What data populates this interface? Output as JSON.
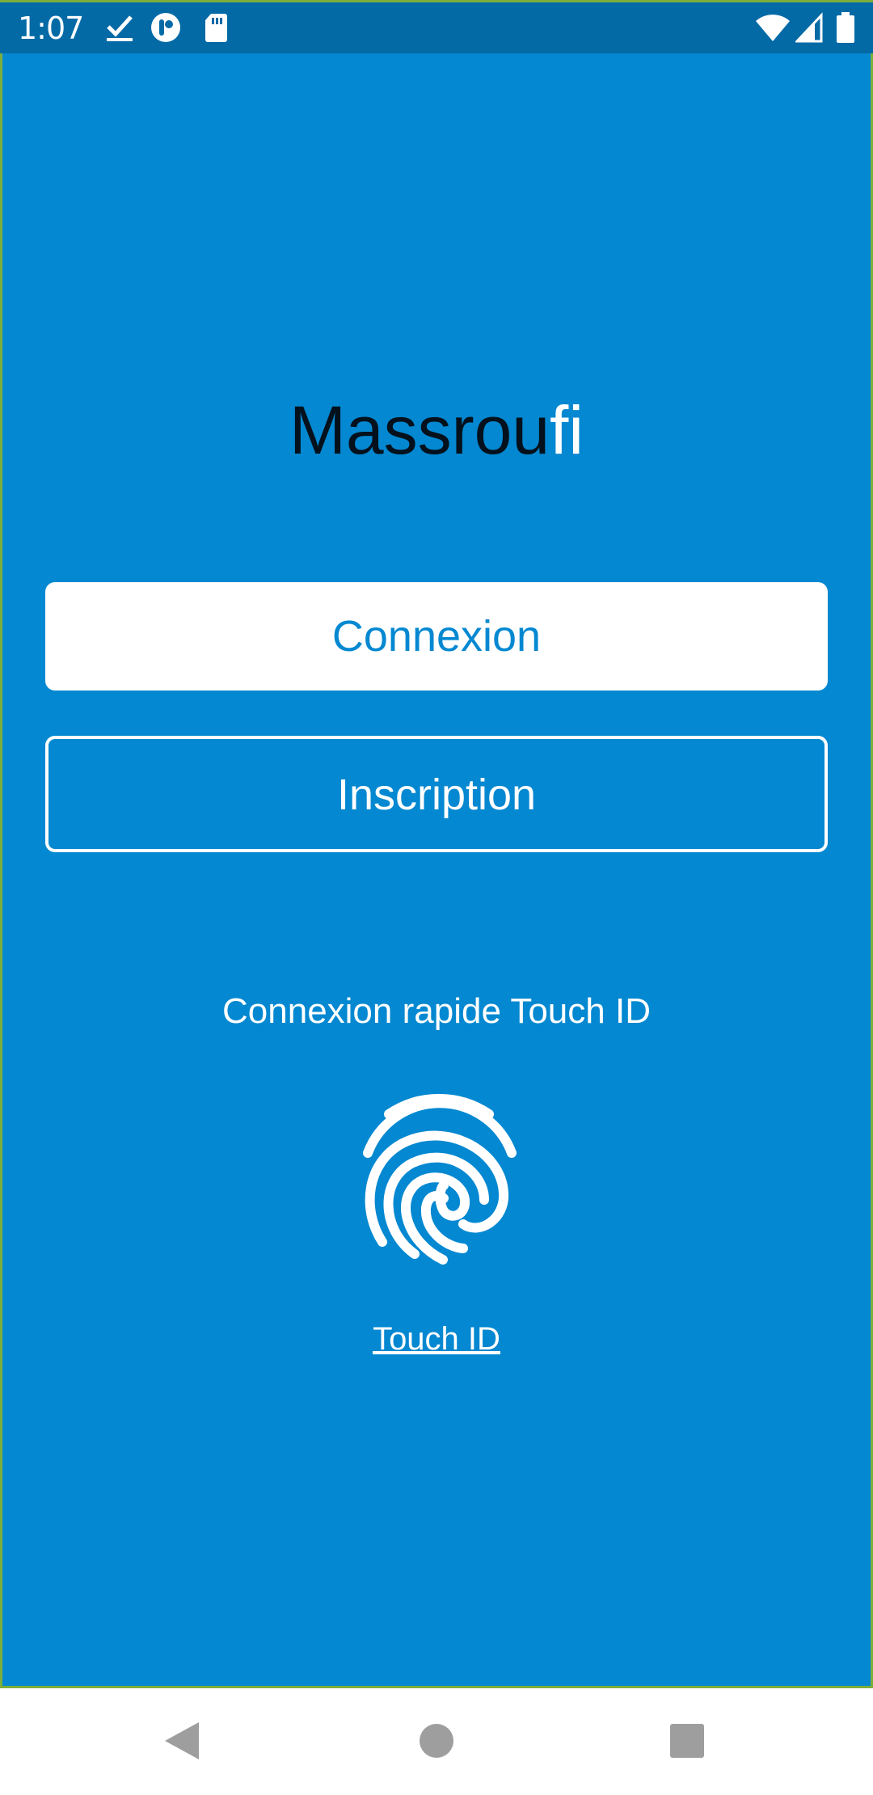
{
  "status_bar": {
    "time": "1:07",
    "left_icons": [
      "checkmark-download-icon",
      "app-notification-icon",
      "sd-card-icon"
    ],
    "right_icons": [
      "wifi-icon",
      "cell-signal-icon",
      "battery-icon"
    ]
  },
  "app": {
    "title_part1": "Massrou",
    "title_part2": "fi",
    "login_label": "Connexion",
    "signup_label": "Inscription",
    "quick_login_label": "Connexion rapide Touch ID",
    "fingerprint_icon": "fingerprint-icon",
    "touch_id_link": "Touch ID"
  },
  "navigation": {
    "buttons": [
      "back-icon",
      "home-icon",
      "recents-icon"
    ]
  },
  "colors": {
    "status_bar_bg": "#036aa6",
    "app_bg": "#0388d1",
    "button_bg": "#ffffff",
    "button_text": "#0388d1",
    "text_light": "#ffffff",
    "title_dark": "#04111c",
    "nav_icon": "#9e9e9e"
  }
}
